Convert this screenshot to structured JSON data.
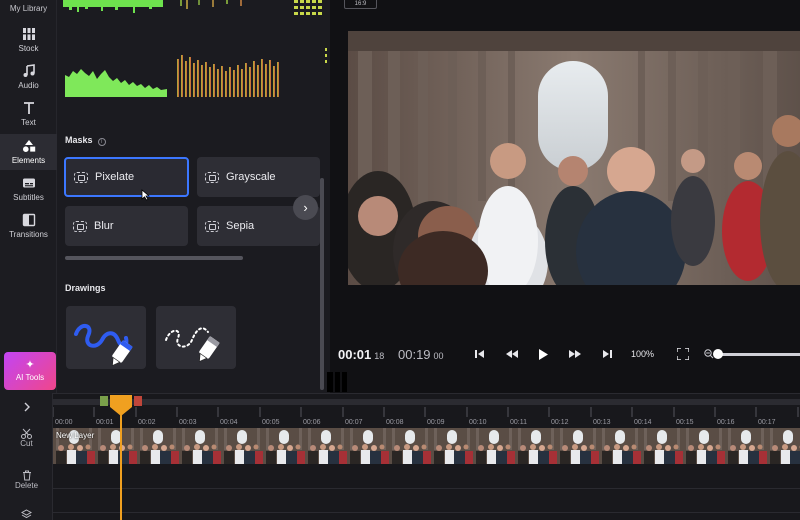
{
  "sidebar": {
    "my_library": "My Library",
    "items": [
      {
        "label": "Stock",
        "icon": "stock-icon"
      },
      {
        "label": "Audio",
        "icon": "music-note-icon"
      },
      {
        "label": "Text",
        "icon": "text-icon"
      },
      {
        "label": "Elements",
        "icon": "shapes-icon"
      },
      {
        "label": "Subtitles",
        "icon": "subtitles-icon"
      },
      {
        "label": "Transitions",
        "icon": "transitions-icon"
      }
    ],
    "active": "Elements",
    "ai_tools": "AI Tools"
  },
  "panel": {
    "masks_title": "Masks",
    "masks": [
      {
        "label": "Pixelate",
        "selected": true
      },
      {
        "label": "Grayscale",
        "selected": false
      },
      {
        "label": "Blur",
        "selected": false
      },
      {
        "label": "Sepia",
        "selected": false
      }
    ],
    "drawings_title": "Drawings"
  },
  "preview": {
    "aspect_ratio": "16:9",
    "current_time": "00:01",
    "current_frame": "18",
    "total_time": "00:19",
    "total_frame": "00",
    "zoom": "100%"
  },
  "timeline": {
    "tools": [
      {
        "label": "Cut",
        "icon": "scissors-icon"
      },
      {
        "label": "Delete",
        "icon": "trash-icon"
      }
    ],
    "ticks": [
      "00:00",
      "00:01",
      "00:02",
      "00:03",
      "00:04",
      "00:05",
      "00:06",
      "00:07",
      "00:08",
      "00:09",
      "00:10",
      "00:11",
      "00:12",
      "00:13",
      "00:14",
      "00:15",
      "00:16",
      "00:17"
    ],
    "layer_label": "New Layer",
    "playhead_time": "00:01",
    "colors": {
      "playhead": "#f0a020",
      "selection": "#3c77ff",
      "ai_gradient_start": "#c245f4",
      "ai_gradient_end": "#f0468a"
    }
  }
}
